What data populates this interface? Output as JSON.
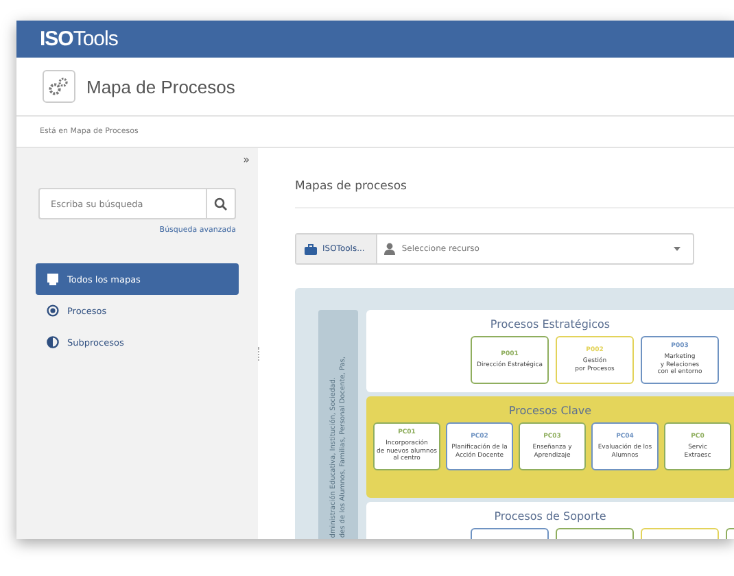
{
  "header": {
    "logo_bold": "ISO",
    "logo_rest": "Tools"
  },
  "page_title": "Mapa de Procesos",
  "breadcrumb": "Está en Mapa de Procesos",
  "sidebar": {
    "collapse": "»",
    "search": {
      "placeholder": "Escriba su búsqueda"
    },
    "advanced_link": "Búsqueda avanzada",
    "items": [
      {
        "label": "Todos los mapas",
        "kind": "all",
        "selected": true
      },
      {
        "label": "Procesos",
        "kind": "process",
        "selected": false
      },
      {
        "label": "Subprocesos",
        "kind": "subprocess",
        "selected": false
      }
    ]
  },
  "main": {
    "heading": "Mapas de procesos",
    "resource_bar": {
      "org": "ISOTools...",
      "placeholder": "Seleccione recurso"
    },
    "map": {
      "stakeholders": [
        "des de los Alumnos, Familias, Personal Docente, Pas,",
        "dministración Educativa, Institución, Sociedad."
      ],
      "sections": [
        {
          "title": "Procesos Estratégicos",
          "kind": "strategic",
          "boxes": [
            {
              "code": "P001",
              "name": "Dirección Estratégica",
              "color": "#8fae5e"
            },
            {
              "code": "P002",
              "name": "Gestión\npor Procesos",
              "color": "#e3d35a"
            },
            {
              "code": "P003",
              "name": "Marketing\ny Relaciones\ncon el entorno",
              "color": "#6f93c2"
            }
          ]
        },
        {
          "title": "Procesos Clave",
          "kind": "key",
          "boxes": [
            {
              "code": "PC01",
              "name": "Incorporación\nde nuevos alumnos\nal centro",
              "color": "#8fae5e"
            },
            {
              "code": "PC02",
              "name": "Planificación de la\nAcción Docente",
              "color": "#6f93c2"
            },
            {
              "code": "PC03",
              "name": "Enseñanza y\nAprendizaje",
              "color": "#8fae5e"
            },
            {
              "code": "PC04",
              "name": "Evaluación de los\nAlumnos",
              "color": "#6f93c2"
            },
            {
              "code": "PC0",
              "name": "Servic\nExtraesc",
              "color": "#8fae5e"
            }
          ]
        },
        {
          "title": "Procesos de Soporte",
          "kind": "support",
          "boxes": [
            {
              "color": "#6f93c2"
            },
            {
              "color": "#8fae5e"
            },
            {
              "color": "#e3d35a"
            },
            {
              "color": "#8fae5e"
            }
          ]
        }
      ]
    }
  }
}
